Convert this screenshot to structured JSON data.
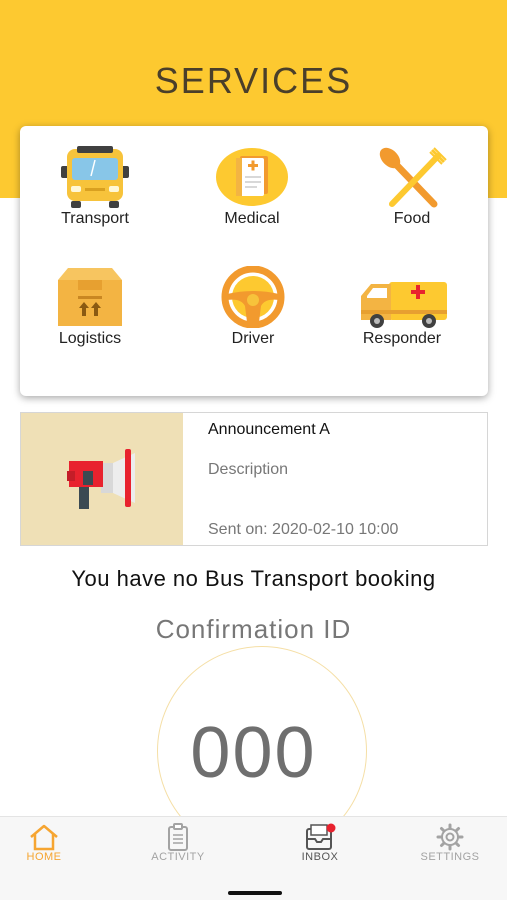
{
  "header": {
    "title": "SERVICES"
  },
  "services": [
    {
      "label": "Transport",
      "icon": "bus-icon"
    },
    {
      "label": "Medical",
      "icon": "medical-record-icon"
    },
    {
      "label": "Food",
      "icon": "spoon-fork-icon"
    },
    {
      "label": "Logistics",
      "icon": "package-box-icon"
    },
    {
      "label": "Driver",
      "icon": "steering-wheel-icon"
    },
    {
      "label": "Responder",
      "icon": "ambulance-icon"
    }
  ],
  "announcement": {
    "title": "Announcement A",
    "description": "Description",
    "sent": "Sent on: 2020-02-10 10:00",
    "icon": "megaphone-icon"
  },
  "booking": {
    "message": "You have no Bus Transport booking",
    "confirmation_label": "Confirmation ID",
    "confirmation_id": "000"
  },
  "tabbar": {
    "tabs": [
      {
        "label": "HOME",
        "icon": "home-icon",
        "active": true
      },
      {
        "label": "ACTIVITY",
        "icon": "clipboard-icon",
        "active": false
      },
      {
        "label": "INBOX",
        "icon": "inbox-icon",
        "active": false,
        "badge": true
      },
      {
        "label": "SETTINGS",
        "icon": "gear-icon",
        "active": false
      }
    ]
  },
  "colors": {
    "brand_yellow": "#fdc930",
    "active_tab": "#f6a531",
    "badge_red": "#e8222e"
  }
}
